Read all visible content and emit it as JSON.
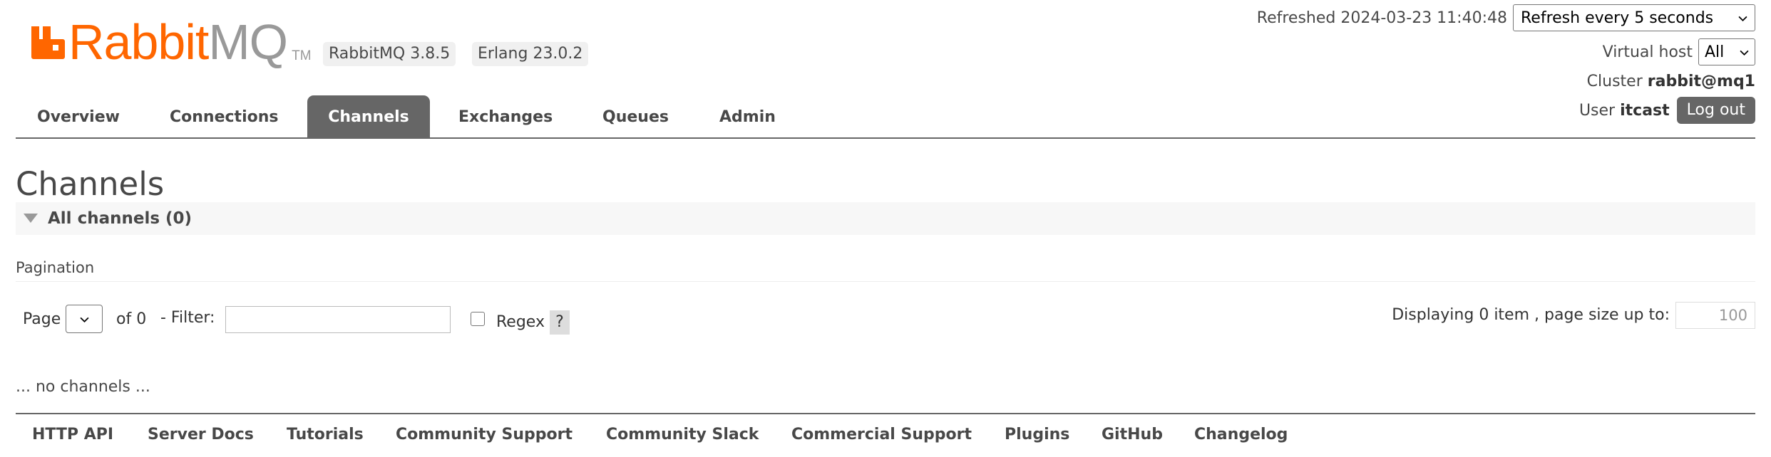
{
  "brand": {
    "logo_text_rabbit": "Rabbit",
    "logo_text_mq": "MQ",
    "logo_tm": "TM",
    "rabbitmq_version": "RabbitMQ 3.8.5",
    "erlang_version": "Erlang 23.0.2",
    "color_orange": "#ff6600",
    "color_grey": "#999999"
  },
  "status": {
    "refreshed_label": "Refreshed 2024-03-23 11:40:48",
    "refresh_select": "Refresh every 5 seconds",
    "vhost_label": "Virtual host",
    "vhost_select": "All",
    "cluster_label": "Cluster",
    "cluster_value": "rabbit@mq1",
    "user_label": "User",
    "user_value": "itcast",
    "logout_label": "Log out"
  },
  "nav": {
    "tabs": [
      {
        "label": "Overview",
        "active": false
      },
      {
        "label": "Connections",
        "active": false
      },
      {
        "label": "Channels",
        "active": true
      },
      {
        "label": "Exchanges",
        "active": false
      },
      {
        "label": "Queues",
        "active": false
      },
      {
        "label": "Admin",
        "active": false
      }
    ],
    "active_color": "#666666"
  },
  "main": {
    "title": "Channels",
    "section_header": "All channels (0)",
    "pagination_label": "Pagination",
    "page_label": "Page",
    "of_label": "of 0",
    "filter_label": "- Filter:",
    "filter_value": "",
    "regex_label": "Regex",
    "regex_checked": false,
    "help_label": "?",
    "displaying_label": "Displaying 0 item , page size up to:",
    "page_size_placeholder": "100",
    "empty_message": "... no channels ..."
  },
  "footer": {
    "links": [
      "HTTP API",
      "Server Docs",
      "Tutorials",
      "Community Support",
      "Community Slack",
      "Commercial Support",
      "Plugins",
      "GitHub",
      "Changelog"
    ]
  },
  "icons": {
    "logo": "rabbitmq-logo-icon",
    "dropdown": "chevron-down-icon",
    "collapse": "triangle-down-icon"
  }
}
